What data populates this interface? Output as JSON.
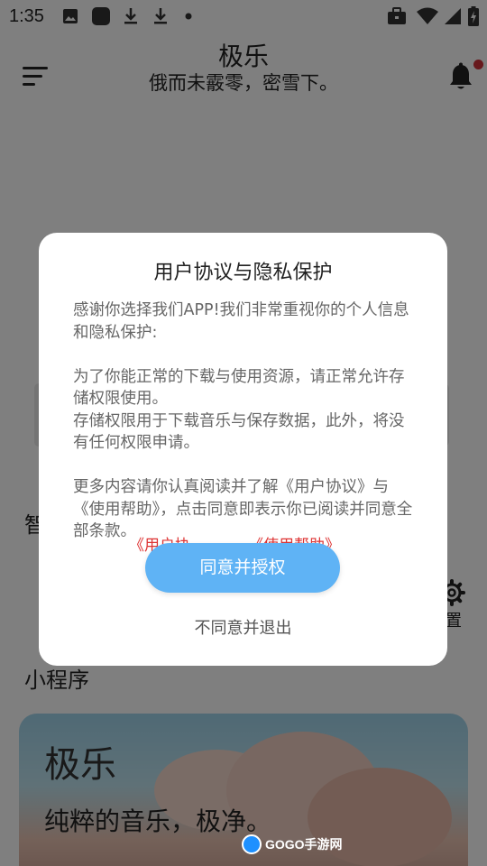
{
  "status_bar": {
    "time": "1:35",
    "left_icons": [
      "gallery-icon",
      "app-icon",
      "download-icon",
      "download-icon",
      "dot-icon"
    ],
    "right_icons": [
      "briefcase-icon",
      "wifi-icon",
      "signal-icon",
      "battery-charging-icon"
    ]
  },
  "header": {
    "title": "极乐",
    "subtitle": "俄而未霰零，密雪下。",
    "menu_icon": "menu-icon",
    "notification_icon": "bell-icon",
    "badge_color": "#d0333a"
  },
  "background": {
    "left_partial_char": "智",
    "settings_label": "置",
    "mini_programs_title": "小程序",
    "banner": {
      "title": "极乐",
      "slogan": "纯粹的音乐，极净。"
    },
    "watermark": "GOGO手游网"
  },
  "dialog": {
    "title": "用户协议与隐私保护",
    "paragraphs": [
      "感谢你选择我们APP!我们非常重视你的个人信息和隐私保护:",
      "为了你能正常的下载与使用资源，请正常允许存储权限使用。\n存储权限用于下载音乐与保存数据，此外，将没有任何权限申请。",
      "更多内容请你认真阅读并了解《用户协议》与《使用帮助》，点击同意即表示你已阅读并同意全部条款。"
    ],
    "link_user_agreement": "《用户协",
    "link_help": "《使用帮助》",
    "agree_button": "同意并授权",
    "decline_button": "不同意并退出",
    "accent_color": "#5fb3f5",
    "link_color": "#d33333"
  }
}
